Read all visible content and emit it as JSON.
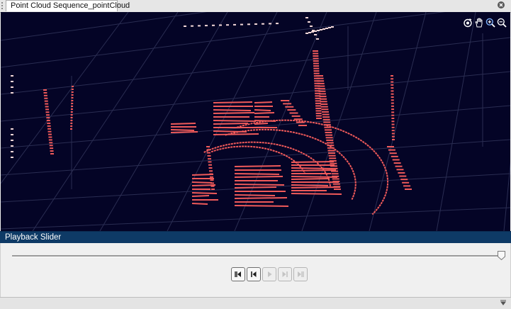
{
  "tab": {
    "title": "Point Cloud Sequence_pointCloud",
    "close_icon": "close-circle-icon"
  },
  "viewer": {
    "background_color": "#040426",
    "point_color": "#f05a5a",
    "toolbar": [
      {
        "name": "rotate-3d-icon",
        "tooltip": "Rotate 3D"
      },
      {
        "name": "pan-icon",
        "tooltip": "Pan"
      },
      {
        "name": "zoom-in-icon",
        "tooltip": "Zoom In"
      },
      {
        "name": "zoom-out-icon",
        "tooltip": "Zoom Out"
      }
    ]
  },
  "playback": {
    "title": "Playback Slider",
    "position_fraction": 1.0,
    "buttons": [
      {
        "name": "first-frame-button",
        "icon": "skip-to-start-icon",
        "enabled": true
      },
      {
        "name": "previous-frame-button",
        "icon": "step-back-icon",
        "enabled": true
      },
      {
        "name": "play-button",
        "icon": "play-icon",
        "enabled": false
      },
      {
        "name": "next-frame-button",
        "icon": "step-forward-icon",
        "enabled": false
      },
      {
        "name": "last-frame-button",
        "icon": "skip-to-end-icon",
        "enabled": false
      }
    ]
  },
  "statusbar": {
    "menu_icon": "chevron-down-icon"
  }
}
